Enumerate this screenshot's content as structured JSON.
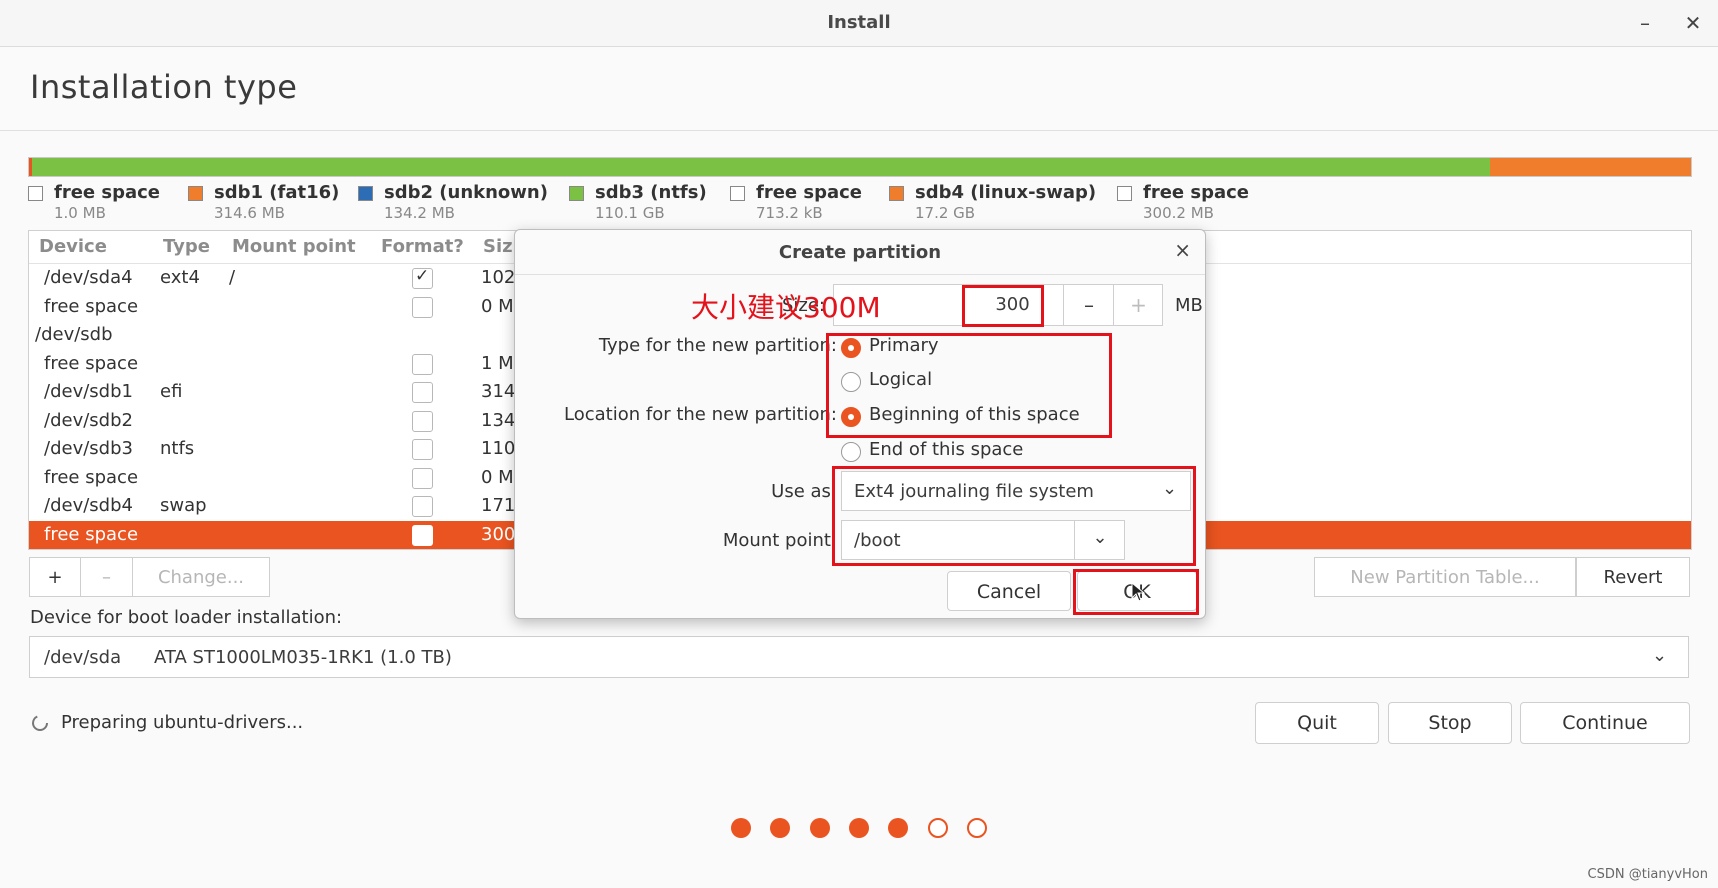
{
  "window": {
    "title": "Install",
    "minimize": "–",
    "close": "✕"
  },
  "page_title": "Installation type",
  "partition_bar": {
    "segments": [
      {
        "color": "#e95420",
        "fraction": 0.002
      },
      {
        "color": "#7bc144",
        "fraction": 0.877
      },
      {
        "color": "#f07d2c",
        "fraction": 0.121
      }
    ]
  },
  "legend": [
    {
      "name": "free space",
      "size": "1.0 MB",
      "color": "#ffffff"
    },
    {
      "name": "sdb1 (fat16)",
      "size": "314.6 MB",
      "color": "#f07d2c"
    },
    {
      "name": "sdb2 (unknown)",
      "size": "134.2 MB",
      "color": "#2d6db5"
    },
    {
      "name": "sdb3 (ntfs)",
      "size": "110.1 GB",
      "color": "#7bc144"
    },
    {
      "name": "free space",
      "size": "713.2 kB",
      "color": "#ffffff"
    },
    {
      "name": "sdb4 (linux-swap)",
      "size": "17.2 GB",
      "color": "#f07d2c"
    },
    {
      "name": "free space",
      "size": "300.2 MB",
      "color": "#ffffff"
    }
  ],
  "table": {
    "headers": [
      "Device",
      "Type",
      "Mount point",
      "Format?",
      "Siz"
    ],
    "rows": [
      {
        "device": "/dev/sda4",
        "type": "ext4",
        "mount": "/",
        "format": "checked",
        "size": "102"
      },
      {
        "device": "free space",
        "type": "",
        "mount": "",
        "format": "unchecked",
        "size": "0 M"
      },
      {
        "device": "/dev/sdb",
        "type": "",
        "mount": "",
        "format": "none",
        "size": ""
      },
      {
        "device": "free space",
        "type": "",
        "mount": "",
        "format": "unchecked",
        "size": "1 M"
      },
      {
        "device": "/dev/sdb1",
        "type": "efi",
        "mount": "",
        "format": "unchecked",
        "size": "314"
      },
      {
        "device": "/dev/sdb2",
        "type": "",
        "mount": "",
        "format": "unchecked",
        "size": "134"
      },
      {
        "device": "/dev/sdb3",
        "type": "ntfs",
        "mount": "",
        "format": "unchecked",
        "size": "110"
      },
      {
        "device": "free space",
        "type": "",
        "mount": "",
        "format": "unchecked",
        "size": "0 M"
      },
      {
        "device": "/dev/sdb4",
        "type": "swap",
        "mount": "",
        "format": "unchecked",
        "size": "171"
      },
      {
        "device": "free space",
        "type": "",
        "mount": "",
        "format": "unchecked",
        "size": "300",
        "selected": true
      }
    ]
  },
  "toolbar": {
    "add": "+",
    "remove": "–",
    "change": "Change...",
    "new_table": "New Partition Table...",
    "revert": "Revert"
  },
  "bootloader": {
    "label": "Device for boot loader installation:",
    "device": "/dev/sda",
    "description": "ATA ST1000LM035-1RK1 (1.0 TB)"
  },
  "status": {
    "icon": "spinner-icon",
    "text": "Preparing ubuntu-drivers..."
  },
  "buttons": {
    "quit": "Quit",
    "stop": "Stop",
    "continue": "Continue"
  },
  "progress_dots": {
    "total": 7,
    "done": 5
  },
  "dialog": {
    "title": "Create partition",
    "close": "×",
    "size_label": "Size:",
    "size_value": "300",
    "size_unit": "MB",
    "minus": "–",
    "plus": "+",
    "type_label": "Type for the new partition:",
    "type_options": [
      "Primary",
      "Logical"
    ],
    "type_selected": "Primary",
    "location_label": "Location for the new partition:",
    "location_options": [
      "Beginning of this space",
      "End of this space"
    ],
    "location_selected": "Beginning of this space",
    "use_as_label": "Use as:",
    "use_as_value": "Ext4 journaling file system",
    "mount_label": "Mount point:",
    "mount_value": "/boot",
    "cancel": "Cancel",
    "ok": "OK"
  },
  "annotation": {
    "text": "大小建议300M",
    "color": "#e3121b"
  },
  "watermark": "CSDN @tianyvHon",
  "colors": {
    "accent": "#e95420",
    "annotation_red": "#e3121b"
  }
}
